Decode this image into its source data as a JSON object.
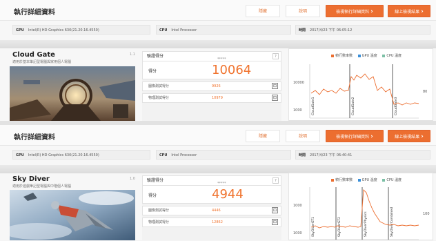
{
  "panels": [
    {
      "title": "執行詳細資料",
      "buttons": {
        "hide": "隱藏",
        "help": "說明",
        "view_details": "檢視執行詳細資料",
        "view_online": "線上檢視結果"
      },
      "info": {
        "gpu_label": "GPU",
        "gpu_value": "Intel(R) HD Graphics 630(21.20.16.4550)",
        "cpu_label": "CPU",
        "cpu_value": "Intel Processor",
        "time_label": "時間",
        "time_value": "2017/4/23 下午 06:05:12"
      },
      "test": {
        "name": "Cloud Gate",
        "subtitle": "適用於基本筆記型電腦與家用個人電腦",
        "version": "1.1",
        "score_header": "驗證得分",
        "stars": "*****",
        "score_label": "得分",
        "score": "10064",
        "graphics_label": "圖像測試得分",
        "graphics_score": "9926",
        "physics_label": "物理測試得分",
        "physics_score": "10979"
      },
      "chart": {
        "legend": [
          "幀行數率數",
          "GPU 溫度",
          "CPU 溫度"
        ],
        "y_ticks": [
          "10000",
          "1000"
        ],
        "right_ticks": [
          "80"
        ],
        "phases": [
          "CloudGate1",
          "CloudGate2",
          "CloudGate3"
        ]
      }
    },
    {
      "title": "執行詳細資料",
      "buttons": {
        "hide": "隱藏",
        "help": "說明",
        "view_details": "檢視執行詳細資料",
        "view_online": "線上檢視結果"
      },
      "info": {
        "gpu_label": "GPU",
        "gpu_value": "Intel(R) HD Graphics 630(21.20.16.4550)",
        "cpu_label": "CPU",
        "cpu_value": "Intel Processor",
        "time_label": "時間",
        "time_value": "2017/4/23 下午 06:40:41"
      },
      "test": {
        "name": "Sky Diver",
        "subtitle": "適用於遊戲筆記型電腦與中階個人電腦",
        "version": "1.0",
        "score_header": "驗證得分",
        "stars": "*****",
        "score_label": "得分",
        "score": "4944",
        "graphics_label": "圖像測試得分",
        "graphics_score": "4446",
        "physics_label": "物理測試得分",
        "physics_score": "12862"
      },
      "chart": {
        "legend": [
          "幀行數率數",
          "GPU 溫度",
          "CPU 溫度"
        ],
        "y_ticks": [
          "1000",
          "1000"
        ],
        "right_ticks": [
          "100"
        ],
        "phases": [
          "SkyDiverGT1",
          "SkyDiverGT2",
          "SkyDiverPhysics",
          "SkyDiverCombined"
        ]
      }
    }
  ],
  "colors": {
    "accent": "#ec6e30",
    "score": "#f0732e",
    "gpu": "#3a8fd9",
    "cpu": "#7cc0a6"
  }
}
